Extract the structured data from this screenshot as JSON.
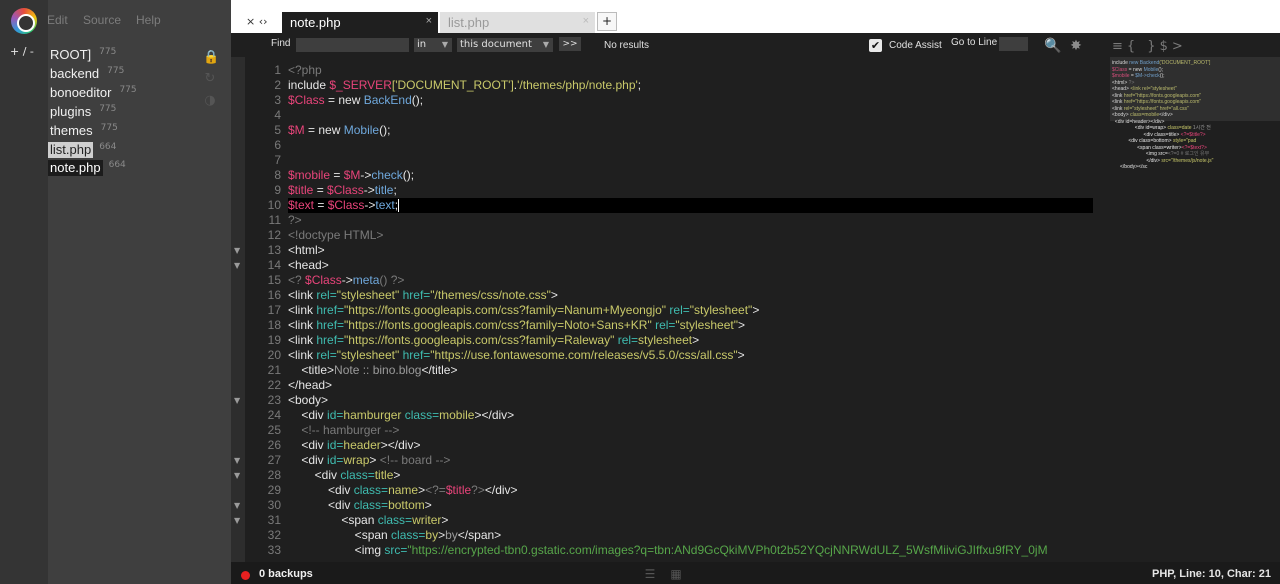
{
  "sidebar": {
    "path_label": "+ / -",
    "menu": [
      "Edit",
      "Source",
      "Help"
    ],
    "tree": [
      {
        "name": "ROOT]",
        "count": "775"
      },
      {
        "name": "backend",
        "count": "775"
      },
      {
        "name": "bonoeditor",
        "count": "775"
      },
      {
        "name": "plugins",
        "count": "775"
      },
      {
        "name": "themes",
        "count": "775"
      },
      {
        "name": "list.php",
        "count": "664"
      },
      {
        "name": "note.php",
        "count": "664"
      }
    ]
  },
  "tabs": {
    "controls": "× ‹›",
    "items": [
      {
        "label": "note.php",
        "close": "×"
      },
      {
        "label": "list.php",
        "close": "×"
      }
    ],
    "add_label": "+"
  },
  "findbar": {
    "find_label": "Find",
    "find_value": "",
    "in_label": "in",
    "scope_value": "this document",
    "go_label": ">>",
    "result_text": "No results",
    "code_assist_label": "Code Assist",
    "code_assist_checked": true,
    "goto_label": "Go to Line"
  },
  "editor": {
    "active_line": 10,
    "lines": [
      [
        [
          "<?php",
          "c"
        ]
      ],
      [
        [
          "include ",
          "x"
        ],
        [
          "$_SERVER",
          "v"
        ],
        [
          "['DOCUMENT_ROOT']",
          "s"
        ],
        [
          ".",
          "x"
        ],
        [
          "'/themes/php/note.php'",
          "s"
        ],
        [
          ";",
          "x"
        ]
      ],
      [
        [
          "$Class",
          "v"
        ],
        [
          " = ",
          "x"
        ],
        [
          "new ",
          "x"
        ],
        [
          "BackEnd",
          "f"
        ],
        [
          "();",
          "x"
        ]
      ],
      [],
      [
        [
          "$M",
          "v"
        ],
        [
          " = ",
          "x"
        ],
        [
          "new ",
          "x"
        ],
        [
          "Mobile",
          "f"
        ],
        [
          "();",
          "x"
        ]
      ],
      [],
      [],
      [
        [
          "$mobile",
          "v"
        ],
        [
          " = ",
          "x"
        ],
        [
          "$M",
          "v"
        ],
        [
          "->",
          "x"
        ],
        [
          "check",
          "f"
        ],
        [
          "();",
          "x"
        ]
      ],
      [
        [
          "$title",
          "v"
        ],
        [
          " = ",
          "x"
        ],
        [
          "$Class",
          "v"
        ],
        [
          "->",
          "x"
        ],
        [
          "title",
          "f"
        ],
        [
          ";",
          "x"
        ]
      ],
      [
        [
          "$text",
          "v"
        ],
        [
          " = ",
          "x"
        ],
        [
          "$Class",
          "v"
        ],
        [
          "->",
          "x"
        ],
        [
          "text",
          "f"
        ],
        [
          ";",
          "x"
        ]
      ],
      [
        [
          "?>",
          "c"
        ]
      ],
      [
        [
          "<!doctype HTML>",
          "c"
        ]
      ],
      [
        [
          "<html>",
          "x"
        ]
      ],
      [
        [
          "<head>",
          "x"
        ]
      ],
      [
        [
          "<? ",
          "c"
        ],
        [
          "$Class",
          "v"
        ],
        [
          "->",
          "x"
        ],
        [
          "meta",
          "f"
        ],
        [
          "() ?>",
          "c"
        ]
      ],
      [
        [
          "<link ",
          "x"
        ],
        [
          "rel=",
          "a"
        ],
        [
          "\"stylesheet\"",
          "s"
        ],
        [
          " href=",
          "a"
        ],
        [
          "\"/themes/css/note.css\"",
          "s"
        ],
        [
          ">",
          "x"
        ]
      ],
      [
        [
          "<link ",
          "x"
        ],
        [
          "href=",
          "a"
        ],
        [
          "\"https://fonts.googleapis.com/css?family=Nanum+Myeongjo\"",
          "s"
        ],
        [
          " rel=",
          "a"
        ],
        [
          "\"stylesheet\"",
          "s"
        ],
        [
          ">",
          "x"
        ]
      ],
      [
        [
          "<link ",
          "x"
        ],
        [
          "href=",
          "a"
        ],
        [
          "\"https://fonts.googleapis.com/css?family=Noto+Sans+KR\"",
          "s"
        ],
        [
          " rel=",
          "a"
        ],
        [
          "\"stylesheet\"",
          "s"
        ],
        [
          ">",
          "x"
        ]
      ],
      [
        [
          "<link ",
          "x"
        ],
        [
          "href=",
          "a"
        ],
        [
          "\"https://fonts.googleapis.com/css?family=Raleway\"",
          "s"
        ],
        [
          " rel=",
          "a"
        ],
        [
          "stylesheet",
          "s"
        ],
        [
          ">",
          "x"
        ]
      ],
      [
        [
          "<link ",
          "x"
        ],
        [
          "rel=",
          "a"
        ],
        [
          "\"stylesheet\"",
          "s"
        ],
        [
          " href=",
          "a"
        ],
        [
          "\"https://use.fontawesome.com/releases/v5.5.0/css/all.css\"",
          "s"
        ],
        [
          ">",
          "x"
        ]
      ],
      [
        [
          "    <title>",
          "x"
        ],
        [
          "Note :: bino.blog",
          "h"
        ],
        [
          "</title>",
          "x"
        ]
      ],
      [
        [
          "</head>",
          "x"
        ]
      ],
      [
        [
          "<body>",
          "x"
        ]
      ],
      [
        [
          "    <div ",
          "x"
        ],
        [
          "id=",
          "a"
        ],
        [
          "hamburger",
          "s"
        ],
        [
          " class=",
          "a"
        ],
        [
          "mobile",
          "s"
        ],
        [
          "></div>",
          "x"
        ]
      ],
      [
        [
          "    <!-- hamburger -->",
          "c"
        ]
      ],
      [
        [
          "    <div ",
          "x"
        ],
        [
          "id=",
          "a"
        ],
        [
          "header",
          "s"
        ],
        [
          "></div>",
          "x"
        ]
      ],
      [
        [
          "    <div ",
          "x"
        ],
        [
          "id=",
          "a"
        ],
        [
          "wrap",
          "s"
        ],
        [
          "> ",
          "x"
        ],
        [
          "<!-- board -->",
          "c"
        ]
      ],
      [
        [
          "        <div ",
          "x"
        ],
        [
          "class=",
          "a"
        ],
        [
          "title",
          "s"
        ],
        [
          ">",
          "x"
        ]
      ],
      [
        [
          "            <div ",
          "x"
        ],
        [
          "class=",
          "a"
        ],
        [
          "name",
          "s"
        ],
        [
          ">",
          "x"
        ],
        [
          "<?=",
          "c"
        ],
        [
          "$title",
          "v"
        ],
        [
          "?>",
          "c"
        ],
        [
          "</div>",
          "x"
        ]
      ],
      [
        [
          "            <div ",
          "x"
        ],
        [
          "class=",
          "a"
        ],
        [
          "bottom",
          "s"
        ],
        [
          ">",
          "x"
        ]
      ],
      [
        [
          "                <span ",
          "x"
        ],
        [
          "class=",
          "a"
        ],
        [
          "writer",
          "s"
        ],
        [
          ">",
          "x"
        ]
      ],
      [
        [
          "                    <span ",
          "x"
        ],
        [
          "class=",
          "a"
        ],
        [
          "by",
          "s"
        ],
        [
          ">",
          "x"
        ],
        [
          "by",
          "h"
        ],
        [
          "</span>",
          "x"
        ]
      ],
      [
        [
          "                    <img ",
          "x"
        ],
        [
          "src=",
          "a"
        ],
        [
          "\"https://encrypted-tbn0.gstatic.com/images?q=tbn:ANd9GcQkiMVPh0t2b52YQcjNNRWdULZ_5WsfMiiviGJIffxu9fRY_0jM",
          "g"
        ]
      ]
    ]
  },
  "minimap": {
    "lines": [
      [
        [
          "include ",
          "x"
        ],
        [
          "new Backend",
          "f"
        ],
        [
          "('DOCUMENT_ROOT']",
          "s"
        ]
      ],
      [
        [
          "$Class",
          "v"
        ],
        [
          " = new ",
          "x"
        ],
        [
          "Mobile",
          "f"
        ],
        [
          "();",
          "x"
        ]
      ],
      [
        [
          "$mobile",
          "v"
        ],
        [
          " = ",
          "x"
        ],
        [
          "$M->check",
          "f"
        ],
        [
          "();",
          "x"
        ]
      ],
      [
        [
          "<html>",
          "x"
        ],
        [
          " ?>",
          "c"
        ]
      ],
      [
        [
          "<head>",
          "x"
        ],
        [
          " <link rel=\"stylesheet\"",
          "s"
        ]
      ],
      [
        [
          "<link ",
          "x"
        ],
        [
          "href=\"https://fonts.googleapis.com\"",
          "s"
        ]
      ],
      [
        [
          "<link ",
          "x"
        ],
        [
          "href=\"https://fonts.googleapis.com\"",
          "s"
        ]
      ],
      [
        [
          "<link ",
          "x"
        ],
        [
          "rel=\"stylesheet\" href=\"all.css\"",
          "s"
        ]
      ],
      [
        [
          "<body>",
          "x"
        ],
        [
          " class=mobile",
          "s"
        ],
        [
          "</div>",
          "x"
        ]
      ],
      [
        [
          "  <div id=header>",
          "x"
        ],
        [
          "</div>",
          "x"
        ]
      ],
      [
        [
          "  <div id=wrap>",
          "x"
        ],
        [
          " class=date",
          "s"
        ],
        [
          " 1시간 전",
          "h"
        ]
      ],
      [
        [
          "    <div class=title>",
          "x"
        ],
        [
          " <?=$title?>",
          "v"
        ]
      ],
      [
        [
          "      <div class=bottom>",
          "x"
        ],
        [
          " style=\"pad",
          "s"
        ]
      ],
      [
        [
          "        <span class=writer>",
          "x"
        ],
        [
          "<?=$text?>",
          "v"
        ]
      ],
      [
        [
          "          <img src=",
          "x"
        ],
        [
          "<?=0 # 로그인 유무",
          "c"
        ]
      ],
      [
        [
          "      </div>",
          "x"
        ],
        [
          " src=\"/themes/js/note.js\"",
          "s"
        ]
      ],
      [
        [
          "</body>",
          "x"
        ],
        [
          "</sc",
          "x"
        ]
      ]
    ]
  },
  "statusbar": {
    "backups": "0 backups",
    "position": "PHP, Line: 10, Char: 21"
  },
  "colors": {
    "keyword_text": "#e6e6e6",
    "variable": "#e8447a",
    "string": "#c9c96a",
    "function": "#6fa8dc",
    "attribute": "#3fbcb0",
    "comment": "#7a7a7a",
    "status_dot": "#e62020"
  }
}
